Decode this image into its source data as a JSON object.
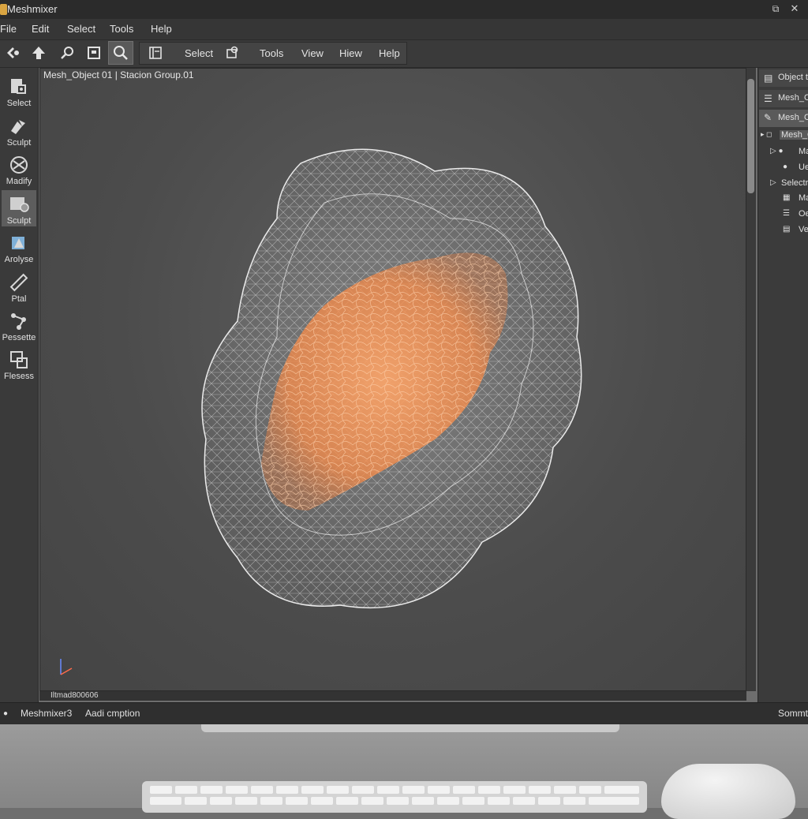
{
  "window": {
    "title": "Meshmixer"
  },
  "menu": [
    "File",
    "Edit",
    "Select",
    "Tools",
    "Help"
  ],
  "toolbar": {
    "icons": [
      "transform-icon",
      "up-arrow-icon",
      "magnify-icon",
      "frame-icon",
      "search-icon",
      "panel-icon",
      "object-icon"
    ],
    "labels": [
      "Select",
      "Tools",
      "View",
      "Hiew",
      "Help"
    ]
  },
  "left_tools": [
    {
      "label": "Select",
      "icon": "select-icon"
    },
    {
      "label": "Sculpt",
      "icon": "brush-icon"
    },
    {
      "label": "Madify",
      "icon": "modify-icon"
    },
    {
      "label": "Sculpt",
      "icon": "sculpt-icon"
    },
    {
      "label": "Arolyse",
      "icon": "analyse-icon"
    },
    {
      "label": "Ptal",
      "icon": "ruler-icon"
    },
    {
      "label": "Pessette",
      "icon": "nodes-icon"
    },
    {
      "label": "Flesess",
      "icon": "grid-icon"
    }
  ],
  "viewport": {
    "breadcrumb": "Mesh_Object 01 |  Stacion Group.01",
    "status": "Iltmad800606",
    "mesh_color": "#f08a4b"
  },
  "right_panel": {
    "rows": [
      {
        "label": "Object t",
        "icon": "panel-icon"
      },
      {
        "label": "Mesh_O",
        "icon": "list-icon"
      },
      {
        "label": "Mesh_O",
        "icon": "pencil-icon"
      },
      {
        "label": "Mesh_O",
        "icon": "triangle-icon"
      },
      {
        "label": "Ma",
        "icon": "user-icon"
      },
      {
        "label": "Ue",
        "icon": "user-icon"
      },
      {
        "label": "Selectr",
        "icon": "triangle-icon"
      },
      {
        "label": "Ma",
        "icon": "grid-icon"
      },
      {
        "label": "Oe",
        "icon": "list-icon"
      },
      {
        "label": "Ve",
        "icon": "print-icon"
      }
    ]
  },
  "statusbar": {
    "left": "Meshmixer3",
    "middle": "Aadi cmption",
    "right": "Sommtr"
  }
}
